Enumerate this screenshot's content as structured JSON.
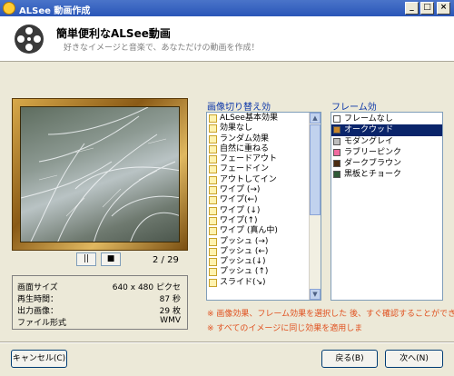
{
  "window": {
    "title": "ALSee 動画作成"
  },
  "header": {
    "title": "簡単便利なALSee動画",
    "subtitle": "好きなイメージと音楽で、あなただけの動画を作成！"
  },
  "preview": {
    "page_counter": "2 / 29",
    "pause_label": "||",
    "stop_label": "■"
  },
  "info": {
    "rows": [
      {
        "label": "画面サイズ",
        "value": "640 x 480 ピクセ"
      },
      {
        "label": "再生時間：",
        "value": "87 秒"
      },
      {
        "label": "出力画像：",
        "value": "29 枚"
      },
      {
        "label": "ファイル形式",
        "value": "WMV"
      }
    ]
  },
  "transitions": {
    "label": "画像切り替え効",
    "items": [
      "ALSee基本効果",
      "効果なし",
      "ランダム効果",
      "自然に重ねる",
      "フェードアウト",
      "フェードイン",
      "アウトしてイン",
      "ワイプ (→)",
      "ワイプ(←)",
      "ワイプ (↓)",
      "ワイプ(↑)",
      "ワイプ (真ん中)",
      "プッシュ (→)",
      "プッシュ (←)",
      "プッシュ(↓)",
      "プッシュ (↑)",
      "スライド(↘)"
    ]
  },
  "frames": {
    "label": "フレーム効",
    "items": [
      {
        "label": "フレームなし",
        "color": "#ffffff"
      },
      {
        "label": "オークウッド",
        "color": "#c8862a"
      },
      {
        "label": "モダングレイ",
        "color": "#bdbdbd"
      },
      {
        "label": "ラブリーピンク",
        "color": "#f06aa0"
      },
      {
        "label": "ダークブラウン",
        "color": "#4a2c12"
      },
      {
        "label": "黒板とチョーク",
        "color": "#2f5a36"
      }
    ],
    "selected_index": 1
  },
  "notes": [
    "※ 画像効果、フレーム効果を選択した 後、すぐ確認することができ",
    "※ すべてのイメージに同じ効果を適用しま"
  ],
  "buttons": {
    "cancel": "キャンセル(C)",
    "back": "戻る(B)",
    "next": "次へ(N)"
  },
  "colors": {
    "accent": "#0a246a",
    "note": "#e0501e",
    "section_label": "#0a35a8"
  }
}
